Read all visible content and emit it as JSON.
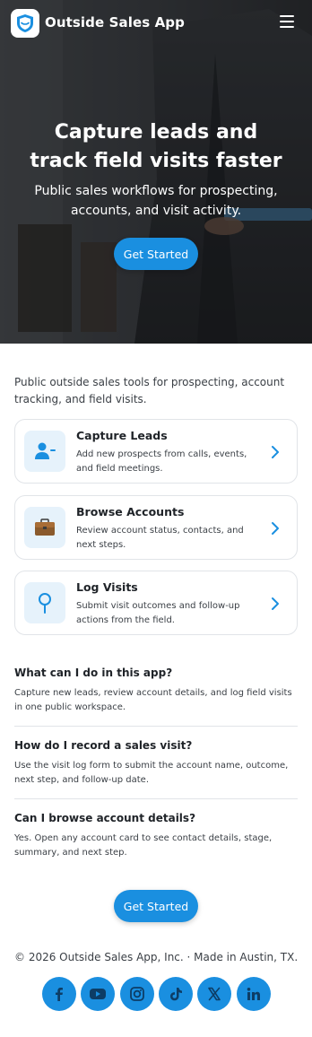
{
  "header": {
    "brand": "Outside Sales App",
    "logo_icon": "shield-icon",
    "menu_icon": "hamburger-icon"
  },
  "hero": {
    "title": "Capture leads and track field visits faster",
    "subtitle": "Public sales workflows for prospecting, accounts, and visit activity.",
    "cta_label": "Get Started"
  },
  "intro": "Public outside sales tools for prospecting, account tracking, and field visits.",
  "cards": [
    {
      "title": "Capture Leads",
      "desc": "Add new prospects from calls, events, and field meetings.",
      "icon": "add-user-icon"
    },
    {
      "title": "Browse Accounts",
      "desc": "Review account status, contacts, and next steps.",
      "icon": "briefcase-icon"
    },
    {
      "title": "Log Visits",
      "desc": "Submit visit outcomes and follow-up actions from the field.",
      "icon": "location-pin-icon"
    }
  ],
  "faq": [
    {
      "q": "What can I do in this app?",
      "a": "Capture new leads, review account details, and log field visits in one public workspace."
    },
    {
      "q": "How do I record a sales visit?",
      "a": "Use the visit log form to submit the account name, outcome, next step, and follow-up date."
    },
    {
      "q": "Can I browse account details?",
      "a": "Yes. Open any account card to see contact details, stage, summary, and next step."
    }
  ],
  "footer": {
    "cta_label": "Get Started",
    "copyright": "© 2026 Outside Sales App, Inc. · Made in Austin, TX.",
    "socials": [
      "facebook-icon",
      "youtube-icon",
      "instagram-icon",
      "tiktok-icon",
      "x-icon",
      "linkedin-icon"
    ]
  },
  "colors": {
    "accent": "#1a8fe0",
    "icon_bg": "#e6f2fb",
    "border": "#e1e4e8"
  }
}
